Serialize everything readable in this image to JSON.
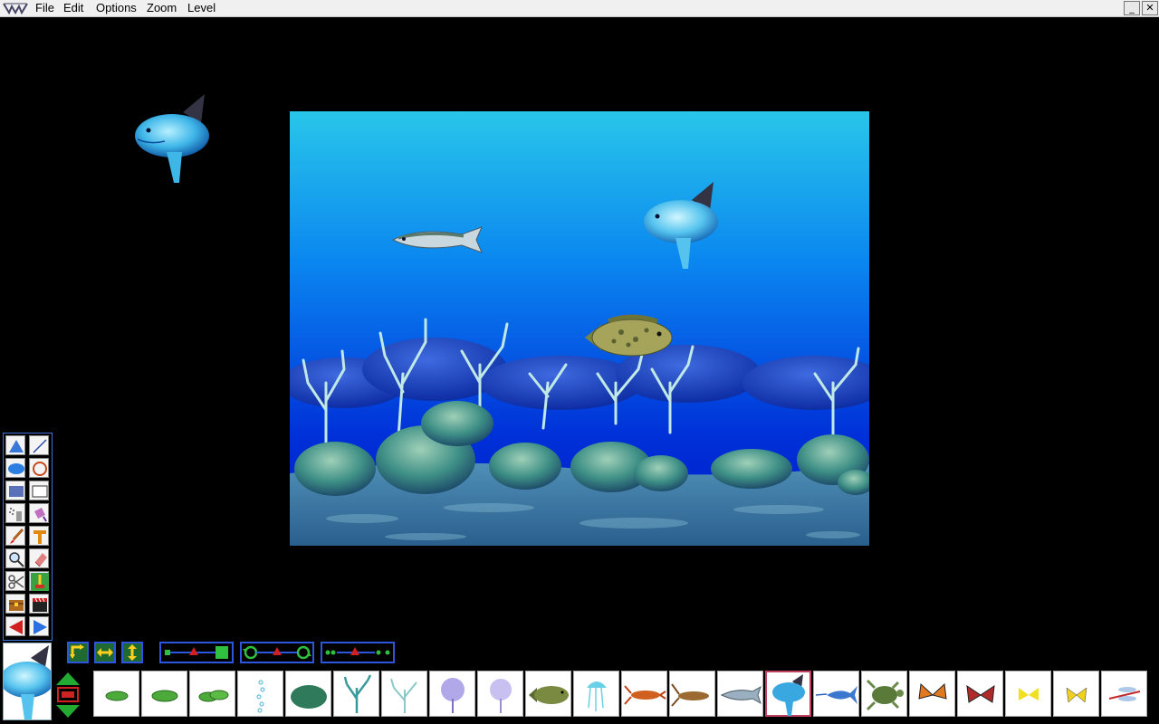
{
  "menubar": {
    "items": [
      {
        "label": "File"
      },
      {
        "label": "Edit"
      },
      {
        "label": "Options"
      },
      {
        "label": "Zoom"
      },
      {
        "label": "Level"
      }
    ],
    "window_controls": {
      "minimize": "_",
      "close": "✕"
    }
  },
  "canvas": {
    "background_top": "#29c6ea",
    "background_bottom": "#0016c8",
    "sprites": [
      "mackerel-sprite",
      "sunfish-sprite",
      "grouper-sprite"
    ]
  },
  "floating_sprite": "sunfish",
  "tools": [
    "triangle-tool",
    "line-tool",
    "filled-ellipse-tool",
    "ellipse-tool",
    "filled-rectangle-tool",
    "rectangle-tool",
    "spray-tool",
    "paint-bucket-tool",
    "brush-tool",
    "text-tool",
    "zoom-tool",
    "eraser-tool",
    "scissors-tool",
    "stamp-tool",
    "treasure-chest-tool",
    "film-clapper-tool",
    "previous-arrow",
    "next-arrow"
  ],
  "controls": {
    "flip": [
      "flip-both-icon",
      "flip-horizontal-icon",
      "flip-vertical-icon"
    ],
    "motion": [
      "path-motion-icon",
      "rotate-motion-icon",
      "dotted-path-icon"
    ],
    "layer_colors": {
      "up": "#22aa33",
      "mid": "#cc2222",
      "down": "#22aa33"
    }
  },
  "strip": {
    "selected_index": 14,
    "items": [
      "green-lilypad-small",
      "green-lilypad-medium",
      "green-lilypad-pair",
      "bubbles-coral",
      "brain-coral",
      "branch-coral",
      "white-coral",
      "purple-sea-fan",
      "lavender-sea-fan",
      "grouper",
      "jellyfish",
      "red-lobster",
      "spiny-lobster",
      "mackerel",
      "sunfish",
      "blue-marlin",
      "sea-turtle",
      "monarch-butterfly",
      "red-butterfly",
      "yellow-butterfly",
      "yellow-swallowtail",
      "dragonfly"
    ]
  },
  "colors": {
    "accent": "#2c55e0",
    "selection": "#c04060"
  }
}
